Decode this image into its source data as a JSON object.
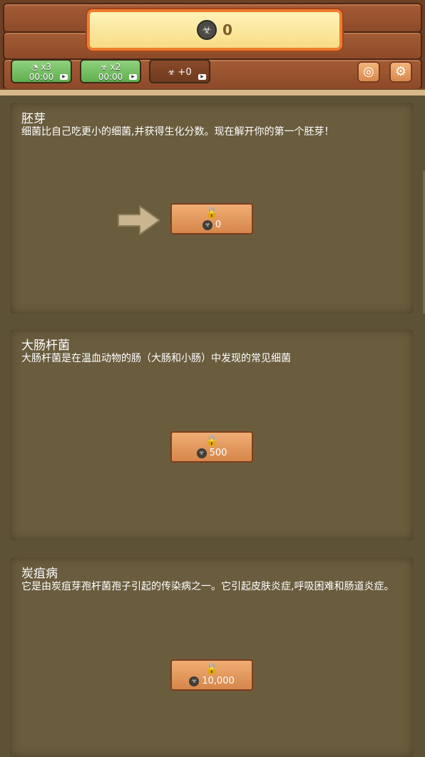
{
  "header": {
    "score_icon": "biohazard-icon",
    "score": "0",
    "boosts": [
      {
        "icon": "speedometer-icon",
        "multiplier": "x3",
        "timer": "00:00"
      },
      {
        "icon": "biohazard-icon",
        "multiplier": "x2",
        "timer": "00:00"
      },
      {
        "icon": "biohazard-icon",
        "label": "+0"
      }
    ],
    "buttons": [
      "lifebuoy-icon",
      "gear-icon"
    ]
  },
  "cards": [
    {
      "title": "胚芽",
      "description": "细菌比自己吃更小的细菌,并获得生化分数。现在解开你的第一个胚芽！",
      "cost": "0",
      "has_arrow": true
    },
    {
      "title": "大肠杆菌",
      "description": "大肠杆菌是在温血动物的肠（大肠和小肠）中发现的常见细菌",
      "cost": "500"
    },
    {
      "title": "炭疽病",
      "description": "它是由炭疽芽孢杆菌孢子引起的传染病之一。它引起皮肤炎症,呼吸困难和肠道炎症。",
      "cost": "10,000"
    }
  ],
  "colors": {
    "background": "#5e5236",
    "panel": "#6a5d3e",
    "header_wood": "#a45c35",
    "banner_border": "#ee7d2e",
    "boost_green": "#6fbe5e",
    "button": "#e69a5f"
  }
}
